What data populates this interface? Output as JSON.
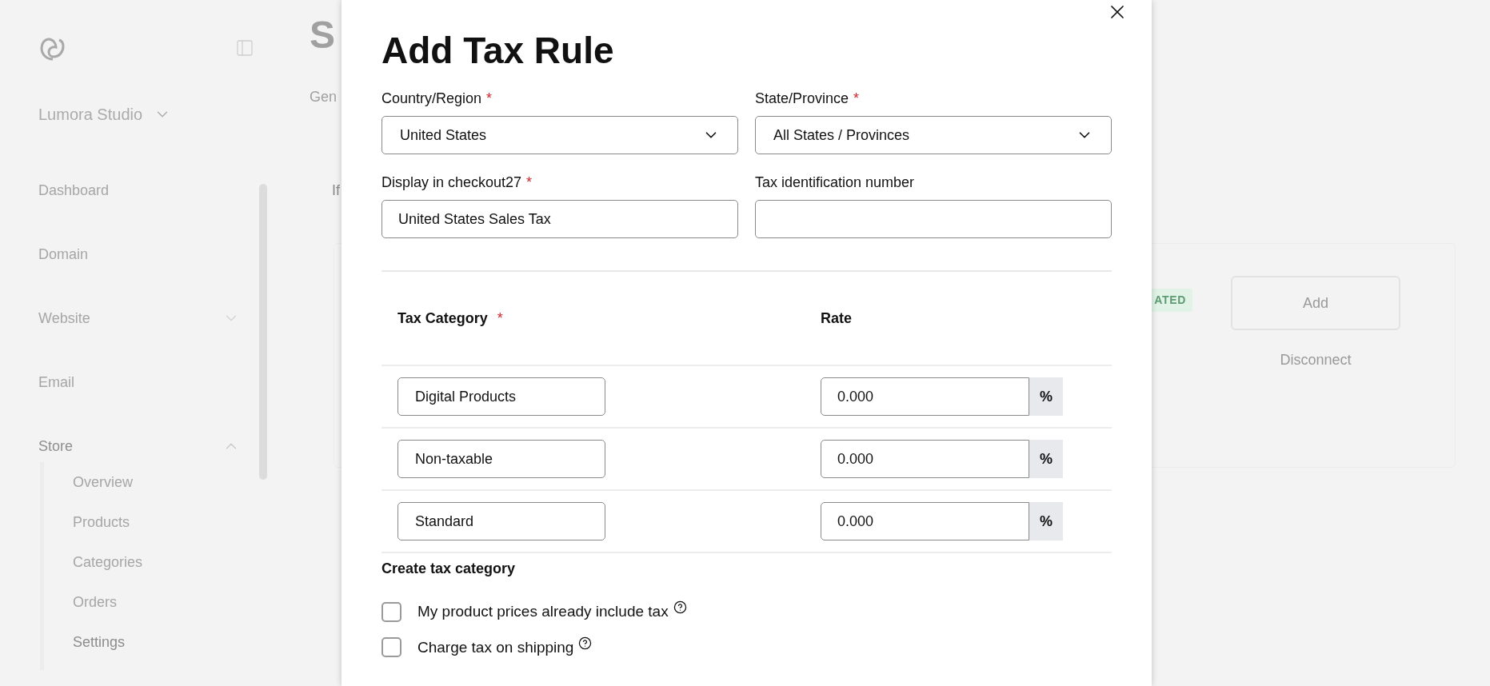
{
  "sidebar": {
    "workspace": "Lumora Studio",
    "items": [
      {
        "label": "Dashboard",
        "kind": "link",
        "selected": false
      },
      {
        "label": "Domain",
        "kind": "link",
        "selected": false
      },
      {
        "label": "Website",
        "kind": "group",
        "expanded": false,
        "selected": false
      },
      {
        "label": "Email",
        "kind": "link",
        "selected": false
      },
      {
        "label": "Store",
        "kind": "group",
        "expanded": true,
        "selected": true,
        "children": [
          {
            "label": "Overview",
            "selected": false
          },
          {
            "label": "Products",
            "selected": false
          },
          {
            "label": "Categories",
            "selected": false
          },
          {
            "label": "Orders",
            "selected": false
          },
          {
            "label": "Settings",
            "selected": true
          }
        ]
      }
    ]
  },
  "page": {
    "title": "S",
    "tab": "Gen",
    "text": "If",
    "badge": "ATED",
    "add_button": "Add",
    "disconnect_link": "Disconnect"
  },
  "modal": {
    "title": "Add Tax Rule",
    "fields": [
      {
        "label": "Country/Region",
        "required_mark": "*",
        "kind": "select",
        "value": "United States"
      },
      {
        "label": "State/Province",
        "required_mark": "*",
        "kind": "select",
        "value": "All States / Provinces"
      },
      {
        "label": "Display in checkout27",
        "required_mark": "*",
        "kind": "text",
        "value": "United States Sales Tax"
      },
      {
        "label": "Tax identification number",
        "kind": "text"
      }
    ],
    "table": {
      "columns": [
        {
          "label": "Tax Category",
          "required_mark": "*"
        },
        {
          "label": "Rate"
        }
      ],
      "rows": [
        {
          "category": "Digital Products",
          "rate": "0.000",
          "unit": "%"
        },
        {
          "category": "Non-taxable",
          "rate": "0.000",
          "unit": "%"
        },
        {
          "category": "Standard",
          "rate": "0.000",
          "unit": "%"
        }
      ]
    },
    "create_link": "Create tax category",
    "options": [
      {
        "label": "My product prices already include tax",
        "checked": false
      },
      {
        "label": "Charge tax on shipping",
        "checked": false
      }
    ]
  }
}
